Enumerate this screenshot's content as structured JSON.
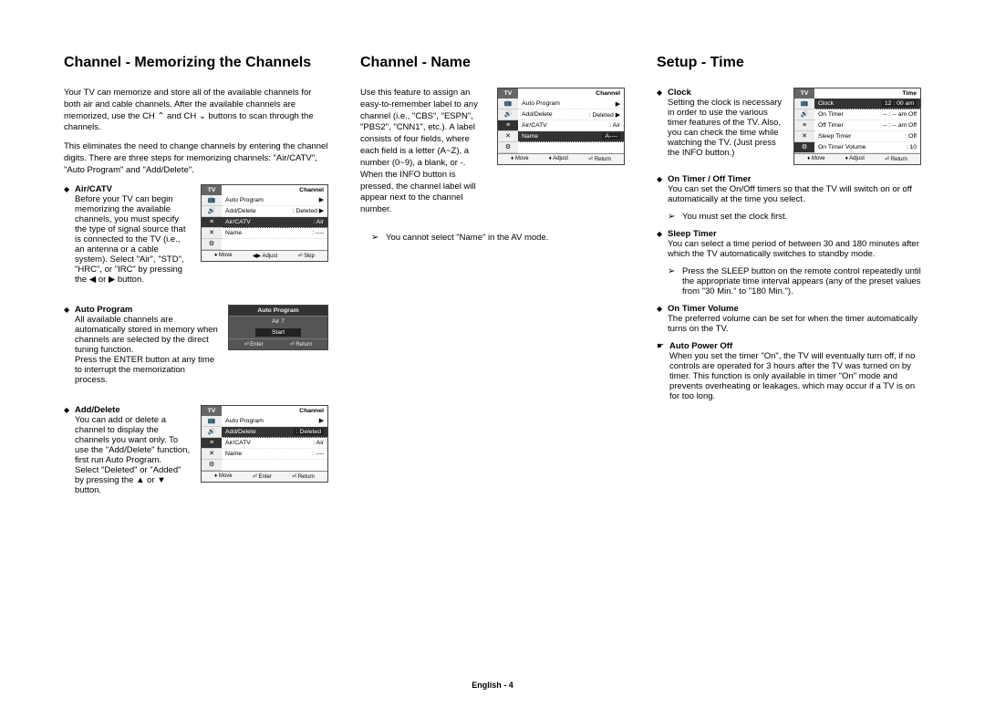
{
  "col1": {
    "heading": "Channel - Memorizing the Channels",
    "intro1": "Your TV can memorize and store all of the available channels for both air and cable channels. After the available channels are memorized, use the CH ⌃ and CH ⌄ buttons to scan through the channels.",
    "intro2": "This eliminates the need to change channels by entering the channel digits. There are three steps for memorizing channels: \"Air/CATV\", \"Auto Program\" and \"Add/Delete\".",
    "s1": {
      "title": "Air/CATV",
      "text": "Before your TV can begin memorizing the available channels, you must specify the type of signal source that is connected to the TV (i.e., an antenna or a cable system). Select \"Air\", \"STD\", \"HRC\", or \"IRC\" by pressing the ◀ or ▶ button."
    },
    "s2": {
      "title": "Auto Program",
      "text": "All available channels are automatically stored in memory when channels are selected by the direct tuning function.",
      "text2": "Press the ENTER button at any time to interrupt the memorization process."
    },
    "s3": {
      "title": "Add/Delete",
      "text": "You can add or delete a channel to display the channels you want only. To use the \"Add/Delete\" function, first run Auto Program.",
      "text2": "Select \"Deleted\" or \"Added\" by pressing the ▲ or ▼ button."
    }
  },
  "osd1": {
    "tv": "TV",
    "title": "Channel",
    "r1a": "Auto Program",
    "r1b": "▶",
    "r2a": "Add/Delete",
    "r2b": ": Deleted ▶",
    "r3a": "Air/CATV",
    "r3b": ": Air",
    "r4a": "Name",
    "r4b": ": ----",
    "f1": "♦ Move",
    "f2": "◀▶ Adjust",
    "f3": "⏎ Skip"
  },
  "osd2": {
    "title": "Auto Program",
    "row": "Air    7",
    "start": "Start",
    "f1": "⏎ Enter",
    "f2": "⏎ Return"
  },
  "osd3": {
    "tv": "TV",
    "title": "Channel",
    "r1a": "Auto Program",
    "r1b": "▶",
    "r2a": "Add/Delete",
    "r2b": ": Deleted",
    "r3a": "Air/CATV",
    "r3b": ": Air",
    "r4a": "Name",
    "r4b": ": ----",
    "f1": "♦ Move",
    "f2": "⏎ Enter",
    "f3": "⏎ Return"
  },
  "col2": {
    "heading": "Channel - Name",
    "text": "Use this feature to assign an easy-to-remember label to any channel (i.e., \"CBS\", \"ESPN\", \"PBS2\", \"CNN1\", etc.). A label consists of four fields, where each field is a letter (A~Z), a number (0~9), a blank, or -. When the INFO button is pressed, the channel label will appear next to the channel number.",
    "note": "You cannot select \"Name\" in the AV mode."
  },
  "osd4": {
    "tv": "TV",
    "title": "Channel",
    "r1a": "Auto Program",
    "r1b": "▶",
    "r2a": "Add/Delete",
    "r2b": ": Deleted ▶",
    "r3a": "Air/CATV",
    "r3b": ": Air",
    "r4a": "Name",
    "r4b": "A----",
    "f1": "♦ Move",
    "f2": "♦ Adjust",
    "f3": "⏎ Return"
  },
  "col3": {
    "heading": "Setup - Time",
    "s1": {
      "title": "Clock",
      "text": "Setting the clock is necessary in order to use the various timer features of the TV. Also, you can check the time while watching the TV. (Just press the INFO button.)"
    },
    "s2": {
      "title": "On Timer / Off Timer",
      "text": "You can set the On/Off timers so that the TV will switch on or off automatically at the time you select.",
      "note": "You must set the clock first."
    },
    "s3": {
      "title": "Sleep Timer",
      "text": "You can select a time period of between 30 and 180 minutes after which the TV automatically switches to standby mode.",
      "note": "Press the SLEEP button on the remote control repeatedly until the appropriate time interval appears (any of the preset values from \"30 Min.\" to \"180 Min.\")."
    },
    "s4": {
      "title": "On Timer Volume",
      "text": "The preferred volume can be set for when the timer automatically turns on the TV."
    },
    "s5": {
      "title": "Auto Power Off",
      "text": "When you set the timer \"On\", the TV will eventually turn off, if no controls are operated for 3 hours after the TV was turned on by timer. This function is only available in timer \"On\" mode and prevents overheating or leakages, which may occur if a TV is on for too long."
    }
  },
  "osd5": {
    "tv": "TV",
    "title": "Time",
    "r1a": "Clock",
    "r1b": "12 : 00 am",
    "r2a": "On Timer",
    "r2b": "-- : --  am  Off",
    "r3a": "Off Timer",
    "r3b": "-- : --  am  Off",
    "r4a": "Sleep Timer",
    "r4b": ":           Off",
    "r5a": "On Timer Volume",
    "r5b": ":            10",
    "f1": "♦ Move",
    "f2": "♦ Adjust",
    "f3": "⏎ Return"
  },
  "footer": "English - 4"
}
